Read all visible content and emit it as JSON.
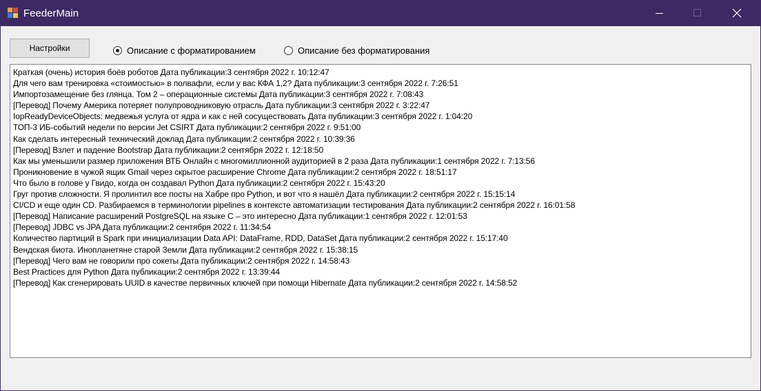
{
  "window": {
    "title": "FeederMain"
  },
  "toolbar": {
    "settings_label": "Настройки",
    "radio_formatted": "Описание с форматированием",
    "radio_plain": "Описание без форматирования",
    "selected": "formatted"
  },
  "feed": {
    "items": [
      "Краткая (очень) история боёв роботов Дата публикации:3 сентября 2022 г. 10:12:47",
      "Для чего вам тренировка «стоимостью» в полвафли, если у вас КФА 1,2? Дата публикации:3 сентября 2022 г. 7:26:51",
      "Импортозамещение без глянца. Том 2 – операционные системы Дата публикации:3 сентября 2022 г. 7:08:43",
      "[Перевод] Почему Америка потеряет полупроводниковую отрасль Дата публикации:3 сентября 2022 г. 3:22:47",
      "IopReadyDeviceObjects: медвежья услуга от ядра и как с ней сосуществовать Дата публикации:3 сентября 2022 г. 1:04:20",
      "ТОП-3 ИБ-событий недели по версии Jet CSIRT Дата публикации:2 сентября 2022 г. 9:51:00",
      "Как сделать интересный технический доклад Дата публикации:2 сентября 2022 г. 10:39:36",
      "[Перевод] Взлет и падение Bootstrap Дата публикации:2 сентября 2022 г. 12:18:50",
      "Как мы уменьшили размер приложения ВТБ Онлайн с многомиллионной аудиторией в 2 раза Дата публикации:1 сентября 2022 г. 7:13:56",
      "Проникновение в чужой ящик Gmail через скрытое расширение Chrome Дата публикации:2 сентября 2022 г. 18:51:17",
      "Что было в голове у Гвидо, когда он создавал Python Дата публикации:2 сентября 2022 г. 15:43:20",
      "Груг против сложности. Я пролинтил все посты на Хабре про Python, и вот что я нашёл Дата публикации:2 сентября 2022 г. 15:15:14",
      "CI/CD и еще один CD. Разбираемся в терминологии pipelines в контексте автоматизации тестирования Дата публикации:2 сентября 2022 г. 16:01:58",
      "[Перевод] Написание расширений PostgreSQL на языке C – это интересно Дата публикации:1 сентября 2022 г. 12:01:53",
      "[Перевод] JDBC vs JPA Дата публикации:2 сентября 2022 г. 11:34:54",
      "Количество партиций в Spark при инициализации Data API: DataFrame, RDD, DataSet Дата публикации:2 сентября 2022 г. 15:17:40",
      "Вендская биота. Инопланетяне старой Земли Дата публикации:2 сентября 2022 г. 15:38:15",
      "[Перевод] Чего вам не говорили про сокеты Дата публикации:2 сентября 2022 г. 14:58:43",
      "Best Practices для Python Дата публикации:2 сентября 2022 г. 13:39:44",
      "[Перевод] Как сгенерировать UUID в качестве первичных ключей при помощи Hibernate Дата публикации:2 сентября 2022 г. 14:58:52"
    ]
  },
  "colors": {
    "titlebar": "#3d2a64",
    "window_bg": "#f0f0f0"
  }
}
